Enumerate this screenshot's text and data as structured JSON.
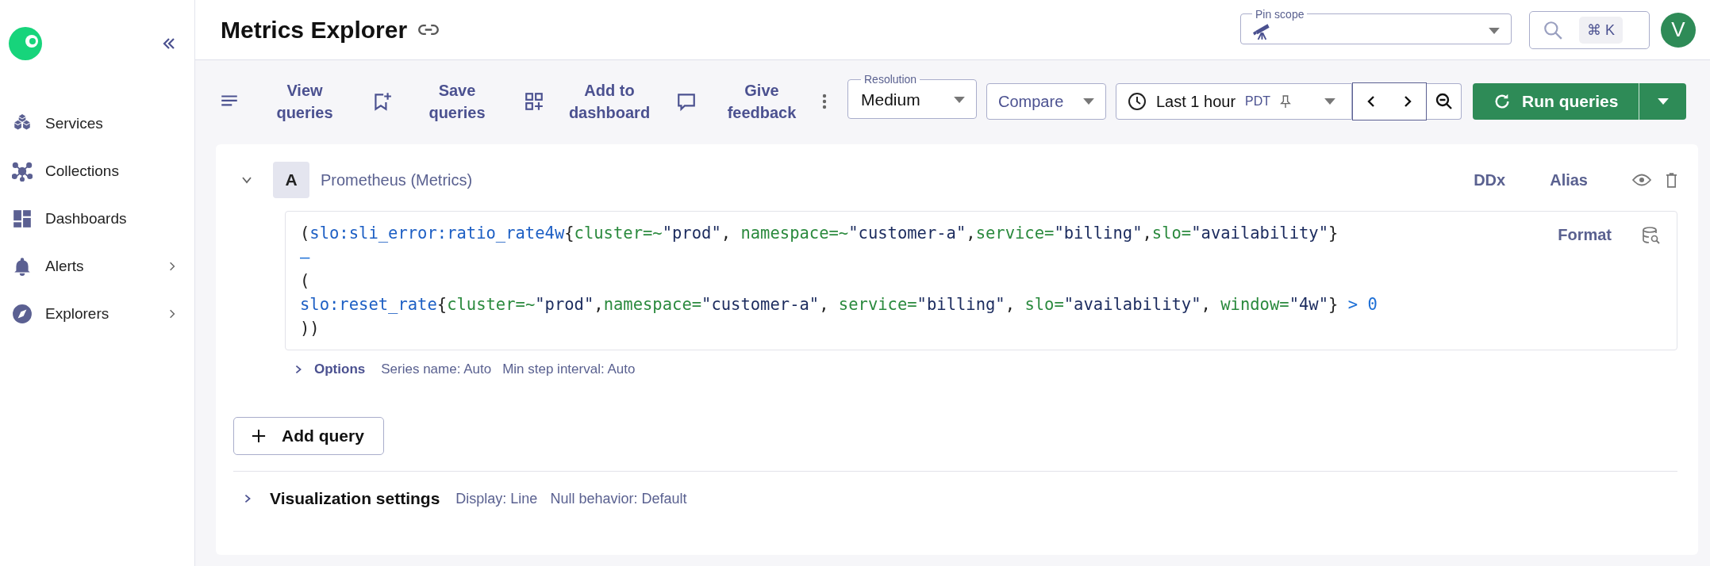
{
  "sidebar": {
    "items": [
      {
        "label": "Services",
        "expandable": false
      },
      {
        "label": "Collections",
        "expandable": false
      },
      {
        "label": "Dashboards",
        "expandable": false
      },
      {
        "label": "Alerts",
        "expandable": true
      },
      {
        "label": "Explorers",
        "expandable": true
      }
    ]
  },
  "header": {
    "title": "Metrics Explorer",
    "pin_scope": {
      "label": "Pin scope"
    },
    "search": {
      "shortcut": "⌘ K"
    },
    "avatar": {
      "initial": "V"
    }
  },
  "toolbar": {
    "actions": [
      {
        "label": "View queries"
      },
      {
        "label": "Save queries"
      },
      {
        "label": "Add to dashboard"
      },
      {
        "label": "Give feedback"
      }
    ],
    "resolution": {
      "label": "Resolution",
      "value": "Medium"
    },
    "compare": {
      "label": "Compare"
    },
    "time_range": {
      "value": "Last 1 hour",
      "timezone": "PDT"
    },
    "run_button": {
      "label": "Run queries"
    }
  },
  "queries": [
    {
      "letter": "A",
      "source": "Prometheus (Metrics)",
      "expanded": true,
      "actions": [
        "DDx",
        "Alias"
      ],
      "format_label": "Format",
      "code": [
        [
          {
            "t": "(",
            "kind": "plain"
          },
          {
            "t": "slo:sli_error:ratio_rate4w",
            "kind": "fn"
          },
          {
            "t": "{",
            "kind": "plain"
          },
          {
            "t": "cluster=~",
            "kind": "label"
          },
          {
            "t": "\"prod\"",
            "kind": "str"
          },
          {
            "t": ", ",
            "kind": "plain"
          },
          {
            "t": "namespace=~",
            "kind": "label"
          },
          {
            "t": "\"customer-a\"",
            "kind": "str"
          },
          {
            "t": ",",
            "kind": "plain"
          },
          {
            "t": "service=",
            "kind": "label"
          },
          {
            "t": "\"billing\"",
            "kind": "str"
          },
          {
            "t": ",",
            "kind": "plain"
          },
          {
            "t": "slo=",
            "kind": "label"
          },
          {
            "t": "\"availability\"",
            "kind": "str"
          },
          {
            "t": "}",
            "kind": "plain"
          }
        ],
        [
          {
            "t": "–",
            "kind": "op"
          }
        ],
        [
          {
            "t": "(",
            "kind": "plain"
          }
        ],
        [
          {
            "t": "slo:reset_rate",
            "kind": "fn"
          },
          {
            "t": "{",
            "kind": "plain"
          },
          {
            "t": "cluster=~",
            "kind": "label"
          },
          {
            "t": "\"prod\"",
            "kind": "str"
          },
          {
            "t": ",",
            "kind": "plain"
          },
          {
            "t": "namespace=",
            "kind": "label"
          },
          {
            "t": "\"customer-a\"",
            "kind": "str"
          },
          {
            "t": ", ",
            "kind": "plain"
          },
          {
            "t": "service=",
            "kind": "label"
          },
          {
            "t": "\"billing\"",
            "kind": "str"
          },
          {
            "t": ", ",
            "kind": "plain"
          },
          {
            "t": "slo=",
            "kind": "label"
          },
          {
            "t": "\"availability\"",
            "kind": "str"
          },
          {
            "t": ", ",
            "kind": "plain"
          },
          {
            "t": "window=",
            "kind": "label"
          },
          {
            "t": "\"4w\"",
            "kind": "str"
          },
          {
            "t": "}",
            "kind": "plain"
          },
          {
            "t": " > 0",
            "kind": "op"
          }
        ],
        [
          {
            "t": "))",
            "kind": "plain"
          }
        ]
      ],
      "options": {
        "label": "Options",
        "expanded": false,
        "details": [
          "Series name: Auto",
          "Min step interval: Auto"
        ]
      }
    }
  ],
  "add_query": {
    "label": "Add query"
  },
  "visualization": {
    "label": "Visualization settings",
    "expanded": false,
    "details": [
      "Display: Line",
      "Null behavior: Default"
    ]
  }
}
